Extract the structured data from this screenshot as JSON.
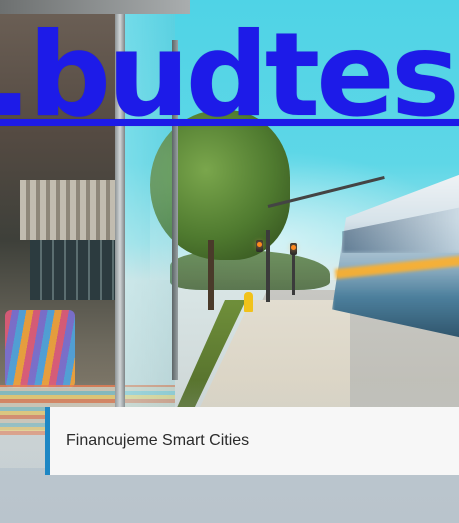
{
  "hero": {
    "image_icon": "street-bus-stop-photo"
  },
  "overlay": {
    "domain_text": ".budtesm"
  },
  "caption": {
    "text": "Financujeme Smart Cities"
  },
  "colors": {
    "link": "#1d1be8",
    "caption_accent": "#1e87c4",
    "caption_bg": "#f7f7f7"
  }
}
